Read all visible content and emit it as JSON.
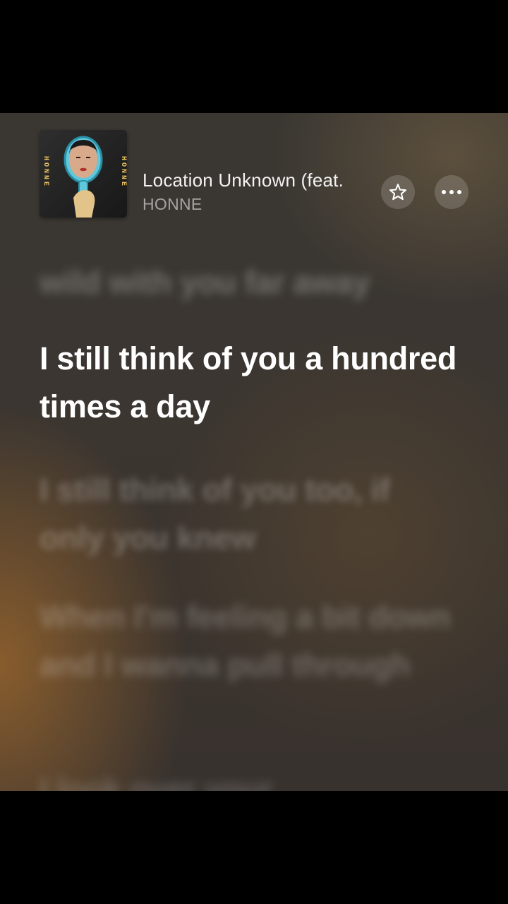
{
  "now_playing": {
    "title": "Location Unknown (feat.",
    "artist": "HONNE",
    "album_art": {
      "label_left": "HONNE",
      "label_right": "HONNE"
    }
  },
  "actions": {
    "favorite_icon": "star-outline-icon",
    "more_icon": "ellipsis-icon"
  },
  "lyrics": {
    "previous": "wild with you far away",
    "current": "I still think of you a hundred times a day",
    "next": [
      "I still think of you too, if only you knew",
      "When I'm feeling a bit down and I wanna pull through",
      "I look over your"
    ]
  },
  "colors": {
    "background_top": "#3a3732",
    "background_warm": "#96642d",
    "active_lyric": "#ffffff",
    "button_fill": "rgba(255,255,255,0.16)"
  }
}
